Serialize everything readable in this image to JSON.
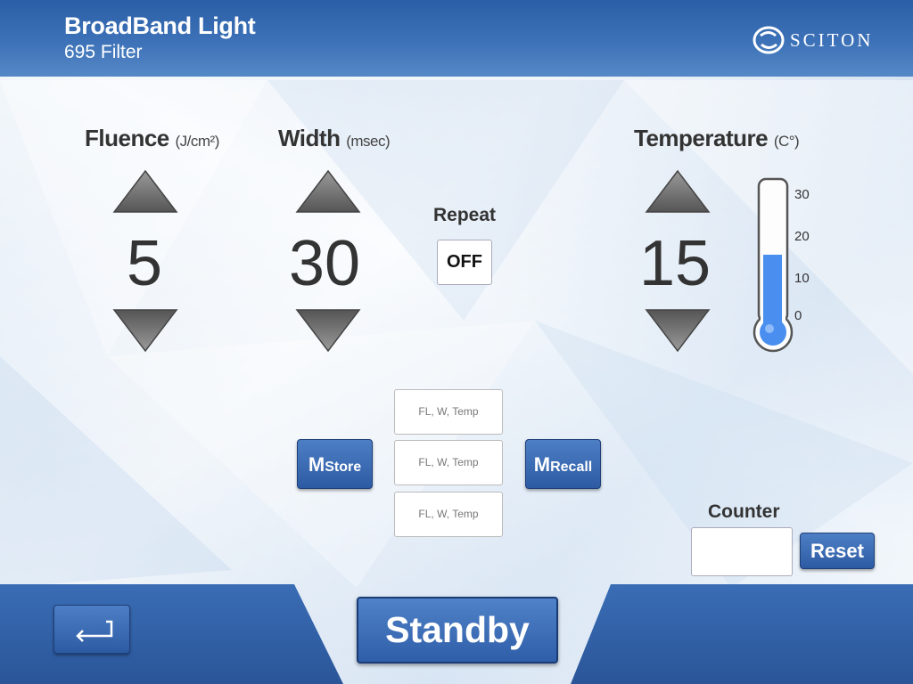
{
  "header": {
    "title": "BroadBand Light",
    "subtitle": "695 Filter",
    "logo_text": "SCITON"
  },
  "fluence": {
    "label": "Fluence",
    "unit": "(J/cm²)",
    "value": "5"
  },
  "width": {
    "label": "Width",
    "unit": "(msec)",
    "value": "30"
  },
  "repeat": {
    "label": "Repeat",
    "state": "OFF"
  },
  "temperature": {
    "label": "Temperature",
    "unit": "(C°)",
    "value": "15",
    "scale_ticks": [
      "30",
      "20",
      "10",
      "0"
    ],
    "level_fraction": 0.5
  },
  "memory": {
    "store_label_big": "M",
    "store_label_small": "Store",
    "recall_label_big": "M",
    "recall_label_small": "Recall",
    "slots": [
      "FL, W, Temp",
      "FL, W, Temp",
      "FL, W, Temp"
    ]
  },
  "counter": {
    "label": "Counter",
    "value": "",
    "reset_label": "Reset"
  },
  "footer": {
    "standby_label": "Standby"
  },
  "colors": {
    "accent": "#2f5ea8",
    "header": "#2a5ea6",
    "thermo_fill": "#4a8ff0"
  },
  "icons": {
    "back": "return-arrow-icon",
    "up": "triangle-up-icon",
    "down": "triangle-down-icon"
  }
}
